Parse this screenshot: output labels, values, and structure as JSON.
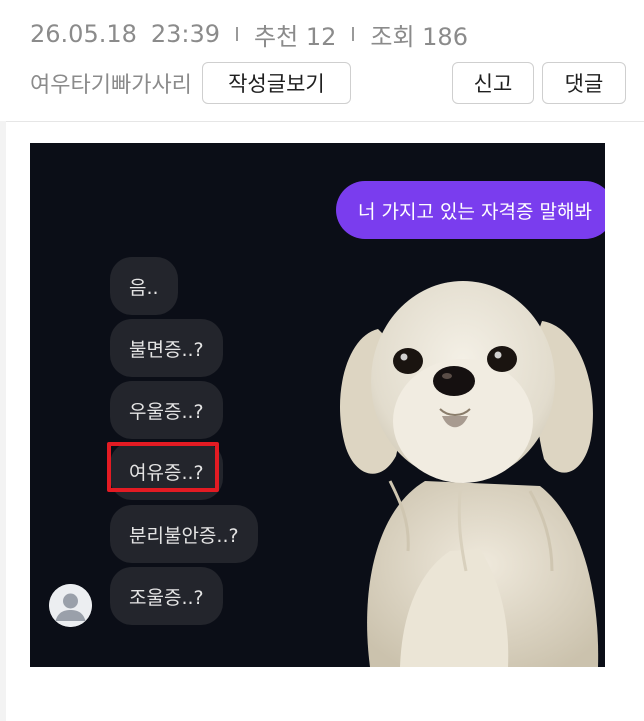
{
  "meta": {
    "date": "26.05.18",
    "time": "23:39",
    "recommend": "추천 12",
    "views": "조회 186"
  },
  "author": {
    "name": "여우타기빠가사리",
    "view_posts_label": "작성글보기"
  },
  "actions": {
    "report_label": "신고",
    "comment_label": "댓글"
  },
  "chat": {
    "outgoing_message": "너 가지고 있는 자격증 말해봐",
    "replies": [
      "음..",
      "불면증..?",
      "우울증..?",
      "여유증..?",
      "분리불안증..?",
      "조울증..?"
    ],
    "highlighted_reply": "여유증..?",
    "highlight_color": "#e31b23",
    "outgoing_color": "#7a3dee",
    "background_color": "#0b0e17"
  },
  "icons": {
    "avatar": "user-avatar-icon",
    "photo": "white-maltese-dog"
  }
}
